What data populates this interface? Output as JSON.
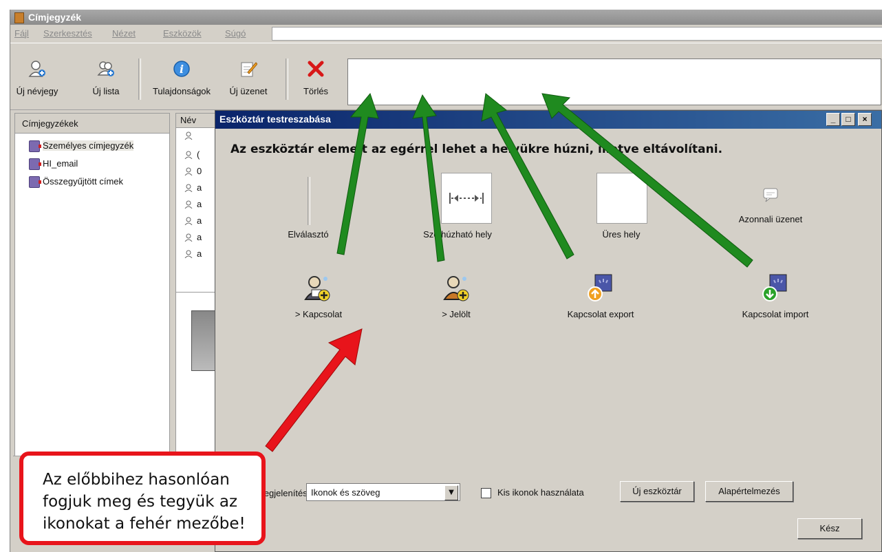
{
  "window": {
    "title": "Címjegyzék"
  },
  "menu": [
    "Fájl",
    "Szerkesztés",
    "Nézet",
    "Eszközök",
    "Súgó"
  ],
  "toolbar": [
    {
      "label": "Új névjegy",
      "icon": "new-contact-icon"
    },
    {
      "label": "Új lista",
      "icon": "new-list-icon"
    },
    {
      "label": "Tulajdonságok",
      "icon": "info-icon"
    },
    {
      "label": "Új üzenet",
      "icon": "compose-icon"
    },
    {
      "label": "Törlés",
      "icon": "delete-icon"
    }
  ],
  "left_pane": {
    "header": "Címjegyzékek",
    "items": [
      "Személyes címjegyzék",
      "HI_email",
      "Összegyűjtött címek"
    ]
  },
  "list_pane": {
    "header": "Név",
    "rows": [
      "",
      "(",
      "0",
      "a",
      "a",
      "a",
      "a",
      "a"
    ]
  },
  "dialog": {
    "title": "Eszköztár testreszabása",
    "instruction": "Az eszköztár elemeit az egérrel lehet a helyükre húzni, illetve eltávolítani.",
    "items": [
      {
        "label": "Elválasztó",
        "icon": "separator-icon"
      },
      {
        "label": "Széthúzható hely",
        "icon": "flexible-space-icon"
      },
      {
        "label": "Üres hely",
        "icon": "space-icon"
      },
      {
        "label": "Azonnali üzenet",
        "icon": "instant-message-icon"
      },
      {
        "label": "> Kapcsolat",
        "icon": "contact-add-icon"
      },
      {
        "label": "> Jelölt",
        "icon": "candidate-add-icon"
      },
      {
        "label": "Kapcsolat export",
        "icon": "contact-export-icon"
      },
      {
        "label": "Kapcsolat import",
        "icon": "contact-import-icon"
      }
    ],
    "show_label": "Megjelenítés:",
    "show_value": "Ikonok és szöveg",
    "small_icons_label": "Kis ikonok használata",
    "small_icons_checked": false,
    "new_toolbar_button": "Új eszköztár",
    "default_button": "Alapértelmezés",
    "done_button": "Kész"
  },
  "callout": {
    "lines": [
      "Az előbbihez hasonlóan",
      "fogjuk meg és tegyük az",
      "ikonokat a fehér mezőbe!"
    ]
  },
  "colors": {
    "title_active": "#0a246a",
    "arrow_green": "#1f8a1f",
    "arrow_red": "#e8141b",
    "callout_border": "#e8141b"
  }
}
